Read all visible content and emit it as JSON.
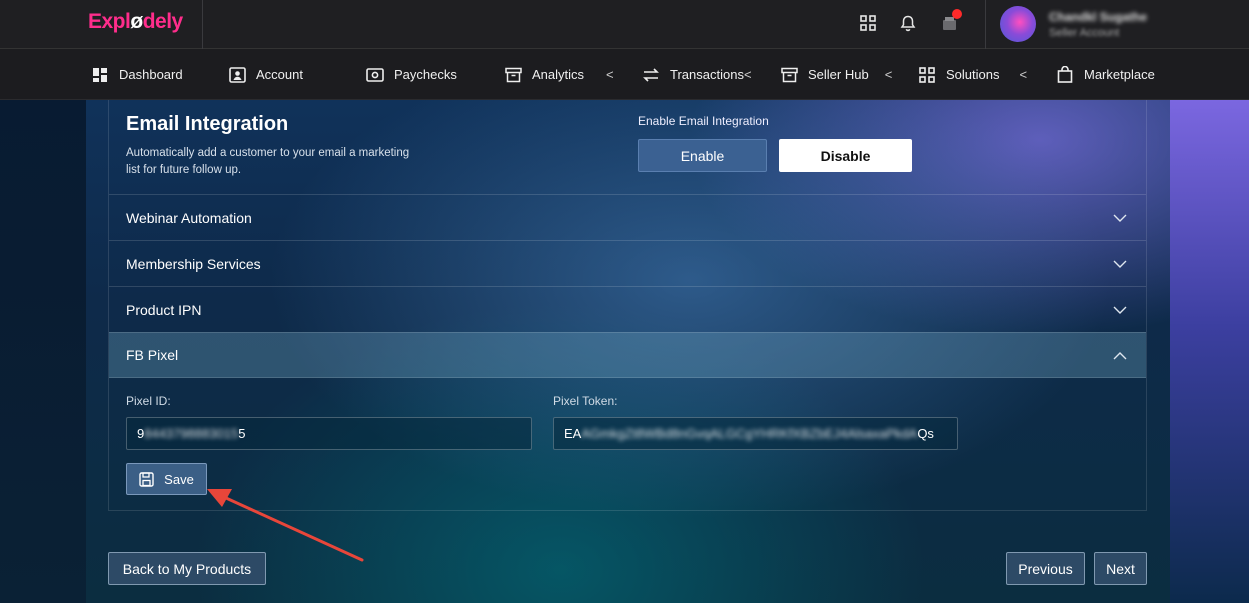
{
  "app": {
    "logo_main": "Expl",
    "logo_mid": "ø",
    "logo_end": "dely",
    "user_name": "Chandkl Sugathe",
    "user_role": "Seller Account"
  },
  "nav": {
    "items": [
      {
        "label": "Dashboard",
        "icon": "dashboard-icon"
      },
      {
        "label": "Account",
        "icon": "account-icon"
      },
      {
        "label": "Paychecks",
        "icon": "paychecks-icon"
      },
      {
        "label": "Analytics",
        "icon": "analytics-icon"
      },
      {
        "label": "Transactions",
        "icon": "transactions-icon"
      },
      {
        "label": "Seller Hub",
        "icon": "seller-hub-icon"
      },
      {
        "label": "Solutions",
        "icon": "solutions-icon"
      },
      {
        "label": "Marketplace",
        "icon": "marketplace-icon"
      }
    ],
    "chevron": "<"
  },
  "email_integration": {
    "title": "Email Integration",
    "description": "Automatically add a customer to your email a marketing list for future follow up.",
    "toggle_label": "Enable Email Integration",
    "enable_label": "Enable",
    "disable_label": "Disable"
  },
  "accordion": {
    "items": [
      {
        "label": "Webinar Automation",
        "expanded": false
      },
      {
        "label": "Membership Services",
        "expanded": false
      },
      {
        "label": "Product IPN",
        "expanded": false
      },
      {
        "label": "FB Pixel",
        "expanded": true
      }
    ]
  },
  "fb_pixel": {
    "pixel_id_label": "Pixel ID:",
    "pixel_id_start": "9",
    "pixel_id_hidden": "8443798883015",
    "pixel_id_end": "5",
    "pixel_token_label": "Pixel Token:",
    "pixel_token_start": "EA",
    "pixel_token_hidden": "AGmkgZt8WBd8nGvqALGCgYHRKfXBZbEJ4AlsaxaPkdA",
    "pixel_token_end": "Qs",
    "save_label": "Save"
  },
  "footer": {
    "back_label": "Back to My Products",
    "previous_label": "Previous",
    "next_label": "Next"
  },
  "colors": {
    "brand_pink": "#ff2d8c",
    "annotation_arrow": "#e8463a",
    "notification_dot": "#ff2a2a"
  }
}
